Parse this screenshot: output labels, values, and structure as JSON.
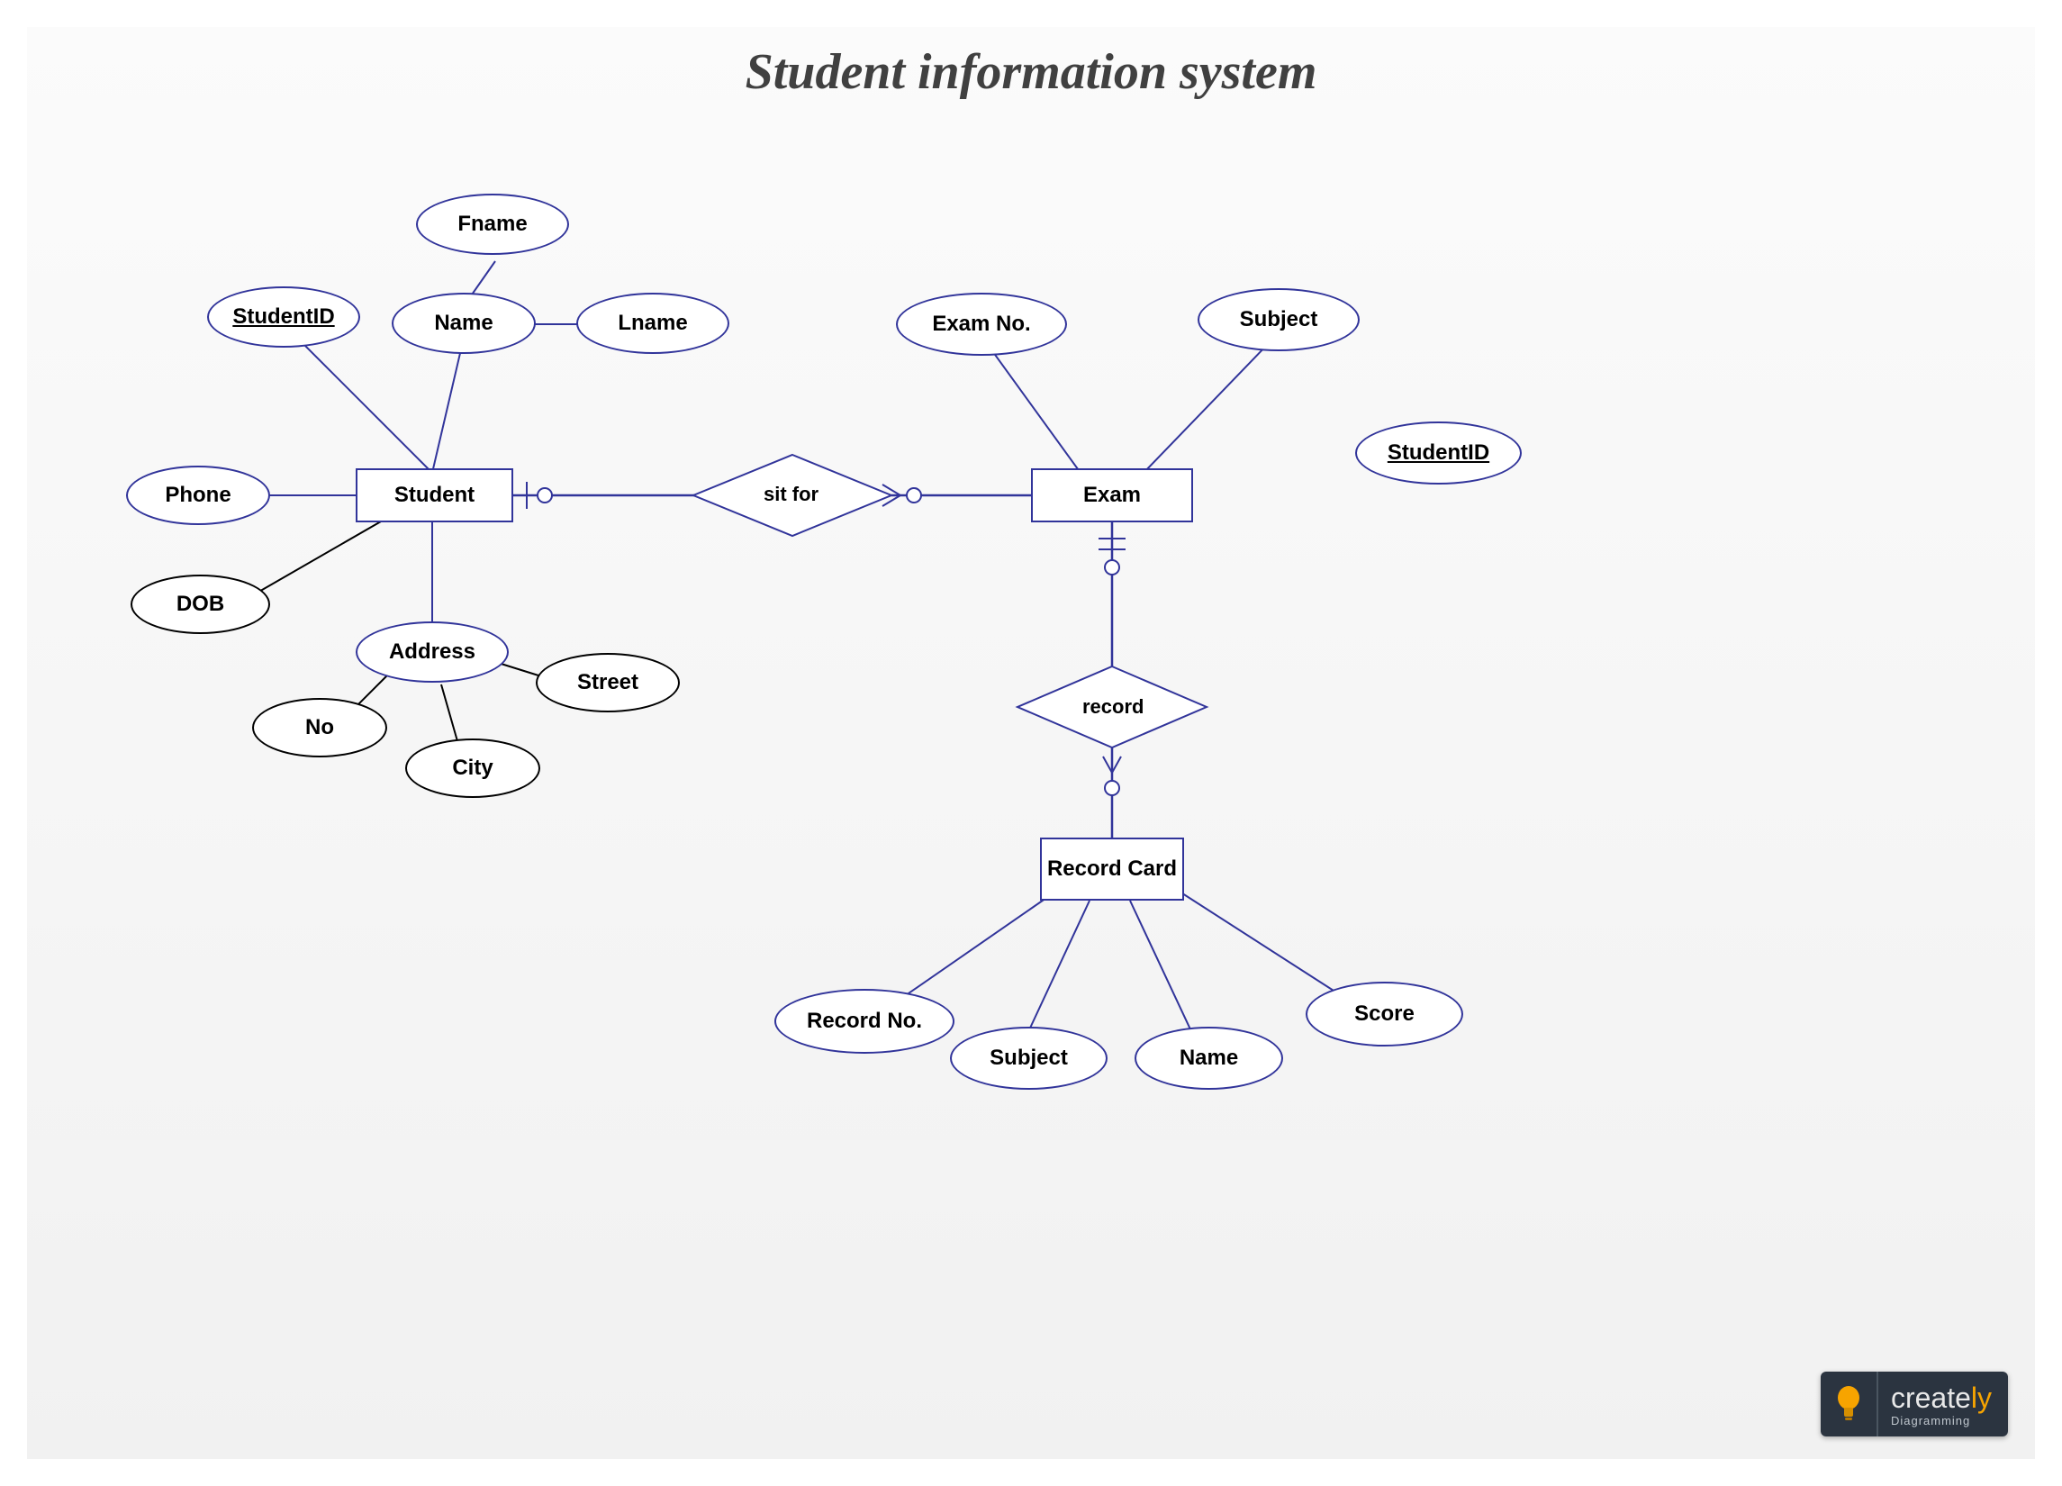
{
  "title": "Student information system",
  "entities": {
    "student": "Student",
    "exam": "Exam",
    "recordcard": "Record Card"
  },
  "relationships": {
    "sitfor": "sit for",
    "record": "record"
  },
  "attributes": {
    "studentid": "StudentID",
    "fname": "Fname",
    "name": "Name",
    "lname": "Lname",
    "phone": "Phone",
    "dob": "DOB",
    "address": "Address",
    "no": "No",
    "city": "City",
    "street": "Street",
    "examno": "Exam No.",
    "subject_exam": "Subject",
    "studentid_exam": "StudentID",
    "recordno": "Record No.",
    "subject_rc": "Subject",
    "name_rc": "Name",
    "score": "Score"
  },
  "logo": {
    "brand_a": "create",
    "brand_b": "ly",
    "sub": "Diagramming"
  }
}
